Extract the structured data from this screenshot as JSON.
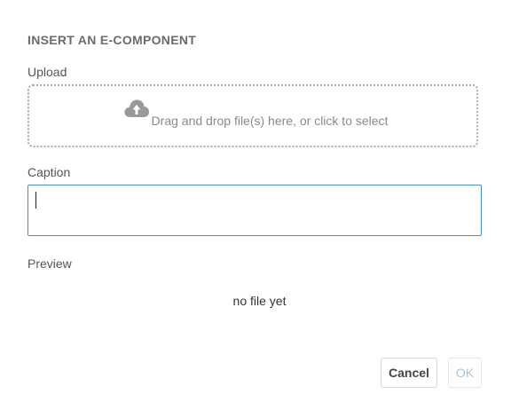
{
  "dialog": {
    "title": "INSERT AN E-COMPONENT",
    "upload": {
      "label": "Upload",
      "icon": "cloud-upload-icon",
      "prompt": "Drag and drop file(s) here, or click to select"
    },
    "caption": {
      "label": "Caption",
      "value": ""
    },
    "preview": {
      "label": "Preview",
      "empty_text": "no file yet"
    },
    "buttons": {
      "cancel_label": "Cancel",
      "ok_label": "OK"
    }
  },
  "colors": {
    "title": "#6b6b6b",
    "input_focus_border": "#4a90c2",
    "dropzone_border": "#a9a9a9",
    "ok_disabled_text": "#a9c3da"
  }
}
